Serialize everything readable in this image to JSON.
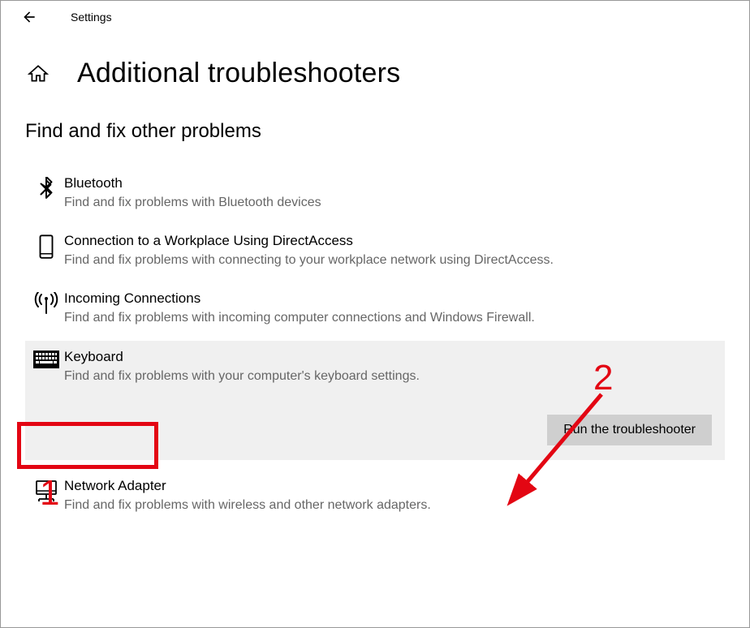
{
  "header": {
    "app_title": "Settings"
  },
  "page": {
    "title": "Additional troubleshooters",
    "section_heading": "Find and fix other problems"
  },
  "troubleshooters": [
    {
      "title": "Bluetooth",
      "desc": "Find and fix problems with Bluetooth devices"
    },
    {
      "title": "Connection to a Workplace Using DirectAccess",
      "desc": "Find and fix problems with connecting to your workplace network using DirectAccess."
    },
    {
      "title": "Incoming Connections",
      "desc": "Find and fix problems with incoming computer connections and Windows Firewall."
    },
    {
      "title": "Keyboard",
      "desc": "Find and fix problems with your computer's keyboard settings."
    },
    {
      "title": "Network Adapter",
      "desc": "Find and fix problems with wireless and other network adapters."
    }
  ],
  "actions": {
    "run_label": "Run the troubleshooter"
  },
  "annotations": {
    "label1": "1",
    "label2": "2"
  }
}
